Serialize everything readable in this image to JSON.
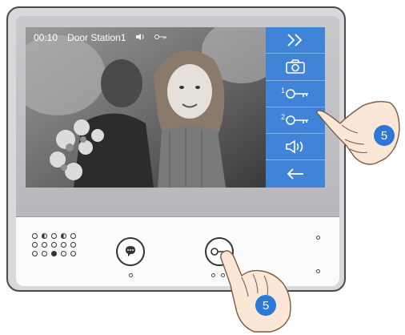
{
  "screen": {
    "timer": "00:10",
    "station": "Door Station1"
  },
  "side_buttons": [
    {
      "name": "skip-forward-icon"
    },
    {
      "name": "camera-icon"
    },
    {
      "name": "unlock-1-icon",
      "label": "1"
    },
    {
      "name": "unlock-2-icon",
      "label": "2"
    },
    {
      "name": "volume-icon"
    },
    {
      "name": "back-arrow-icon"
    }
  ],
  "step_badges": {
    "top": "5",
    "bottom": "5"
  },
  "colors": {
    "accent": "#3f84d6",
    "badge": "#2b78d8"
  }
}
